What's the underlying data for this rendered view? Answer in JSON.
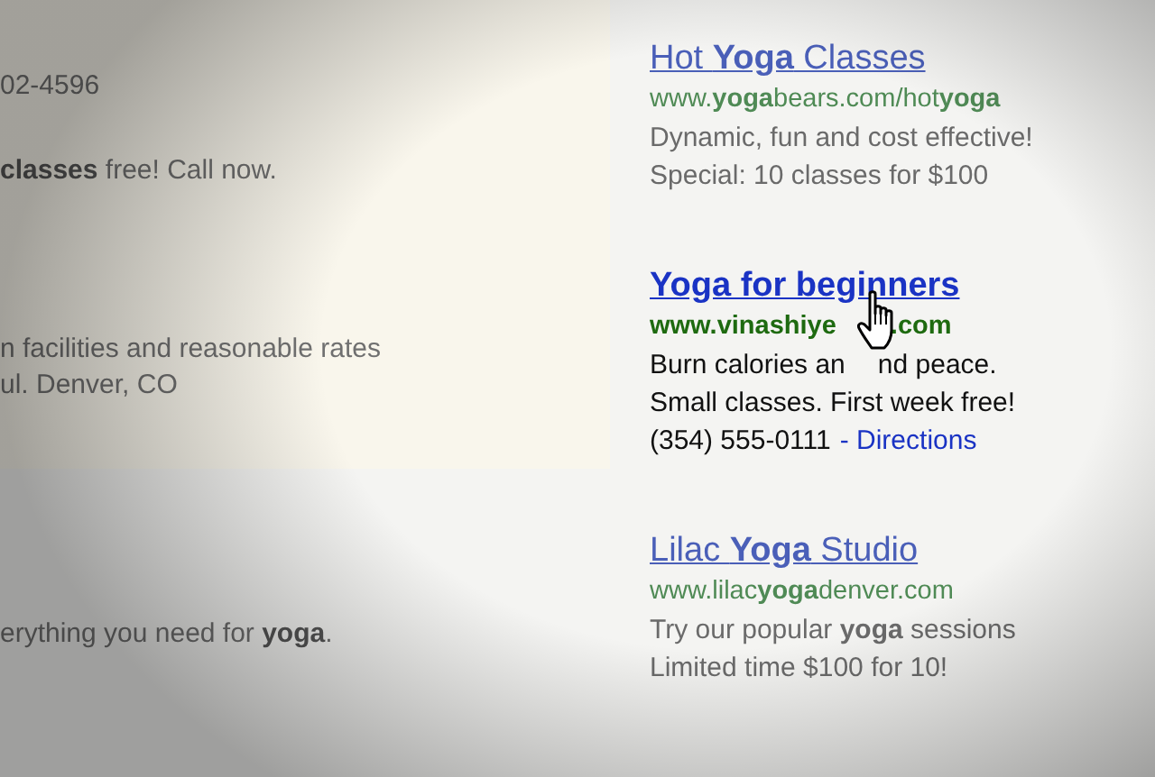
{
  "left_results": [
    {
      "highlighted": true,
      "lines": [
        "02-4596"
      ]
    },
    {
      "highlighted": true,
      "lines": [
        "**classes** free! Call now."
      ]
    },
    {
      "highlighted": true,
      "lines": [
        "n facilities and reasonable rates",
        "ul. Denver, CO"
      ]
    },
    {
      "highlighted": false,
      "lines": [
        "erything you need for **yoga**."
      ]
    }
  ],
  "ads": [
    {
      "focused": false,
      "hovered": false,
      "title": [
        "Hot **Yoga** Classes"
      ],
      "url": [
        "www.**yoga**bears.com/hot**yoga**"
      ],
      "lines": [
        {
          "parts": [
            "Dynamic, fun and cost effective!"
          ]
        },
        {
          "parts": [
            "Special: 10 classes for $100"
          ]
        }
      ]
    },
    {
      "focused": true,
      "hovered": true,
      "title": [
        "Yoga for beginners"
      ],
      "url": [
        "www.vinashiye",
        ".com"
      ],
      "lines": [
        {
          "parts": [
            "Burn calories an",
            "nd peace."
          ]
        },
        {
          "parts": [
            "Small classes. First week free!"
          ]
        },
        {
          "parts": [
            "(354) 555-0111"
          ],
          "link": "- Directions"
        }
      ]
    },
    {
      "focused": false,
      "hovered": false,
      "title": [
        "Lilac **Yoga** Studio"
      ],
      "url": [
        "www.lilac**yoga**denver.com"
      ],
      "lines": [
        {
          "parts": [
            "Try our popular **yoga** sessions"
          ]
        },
        {
          "parts": [
            "Limited time $100 for 10!"
          ]
        }
      ]
    }
  ]
}
